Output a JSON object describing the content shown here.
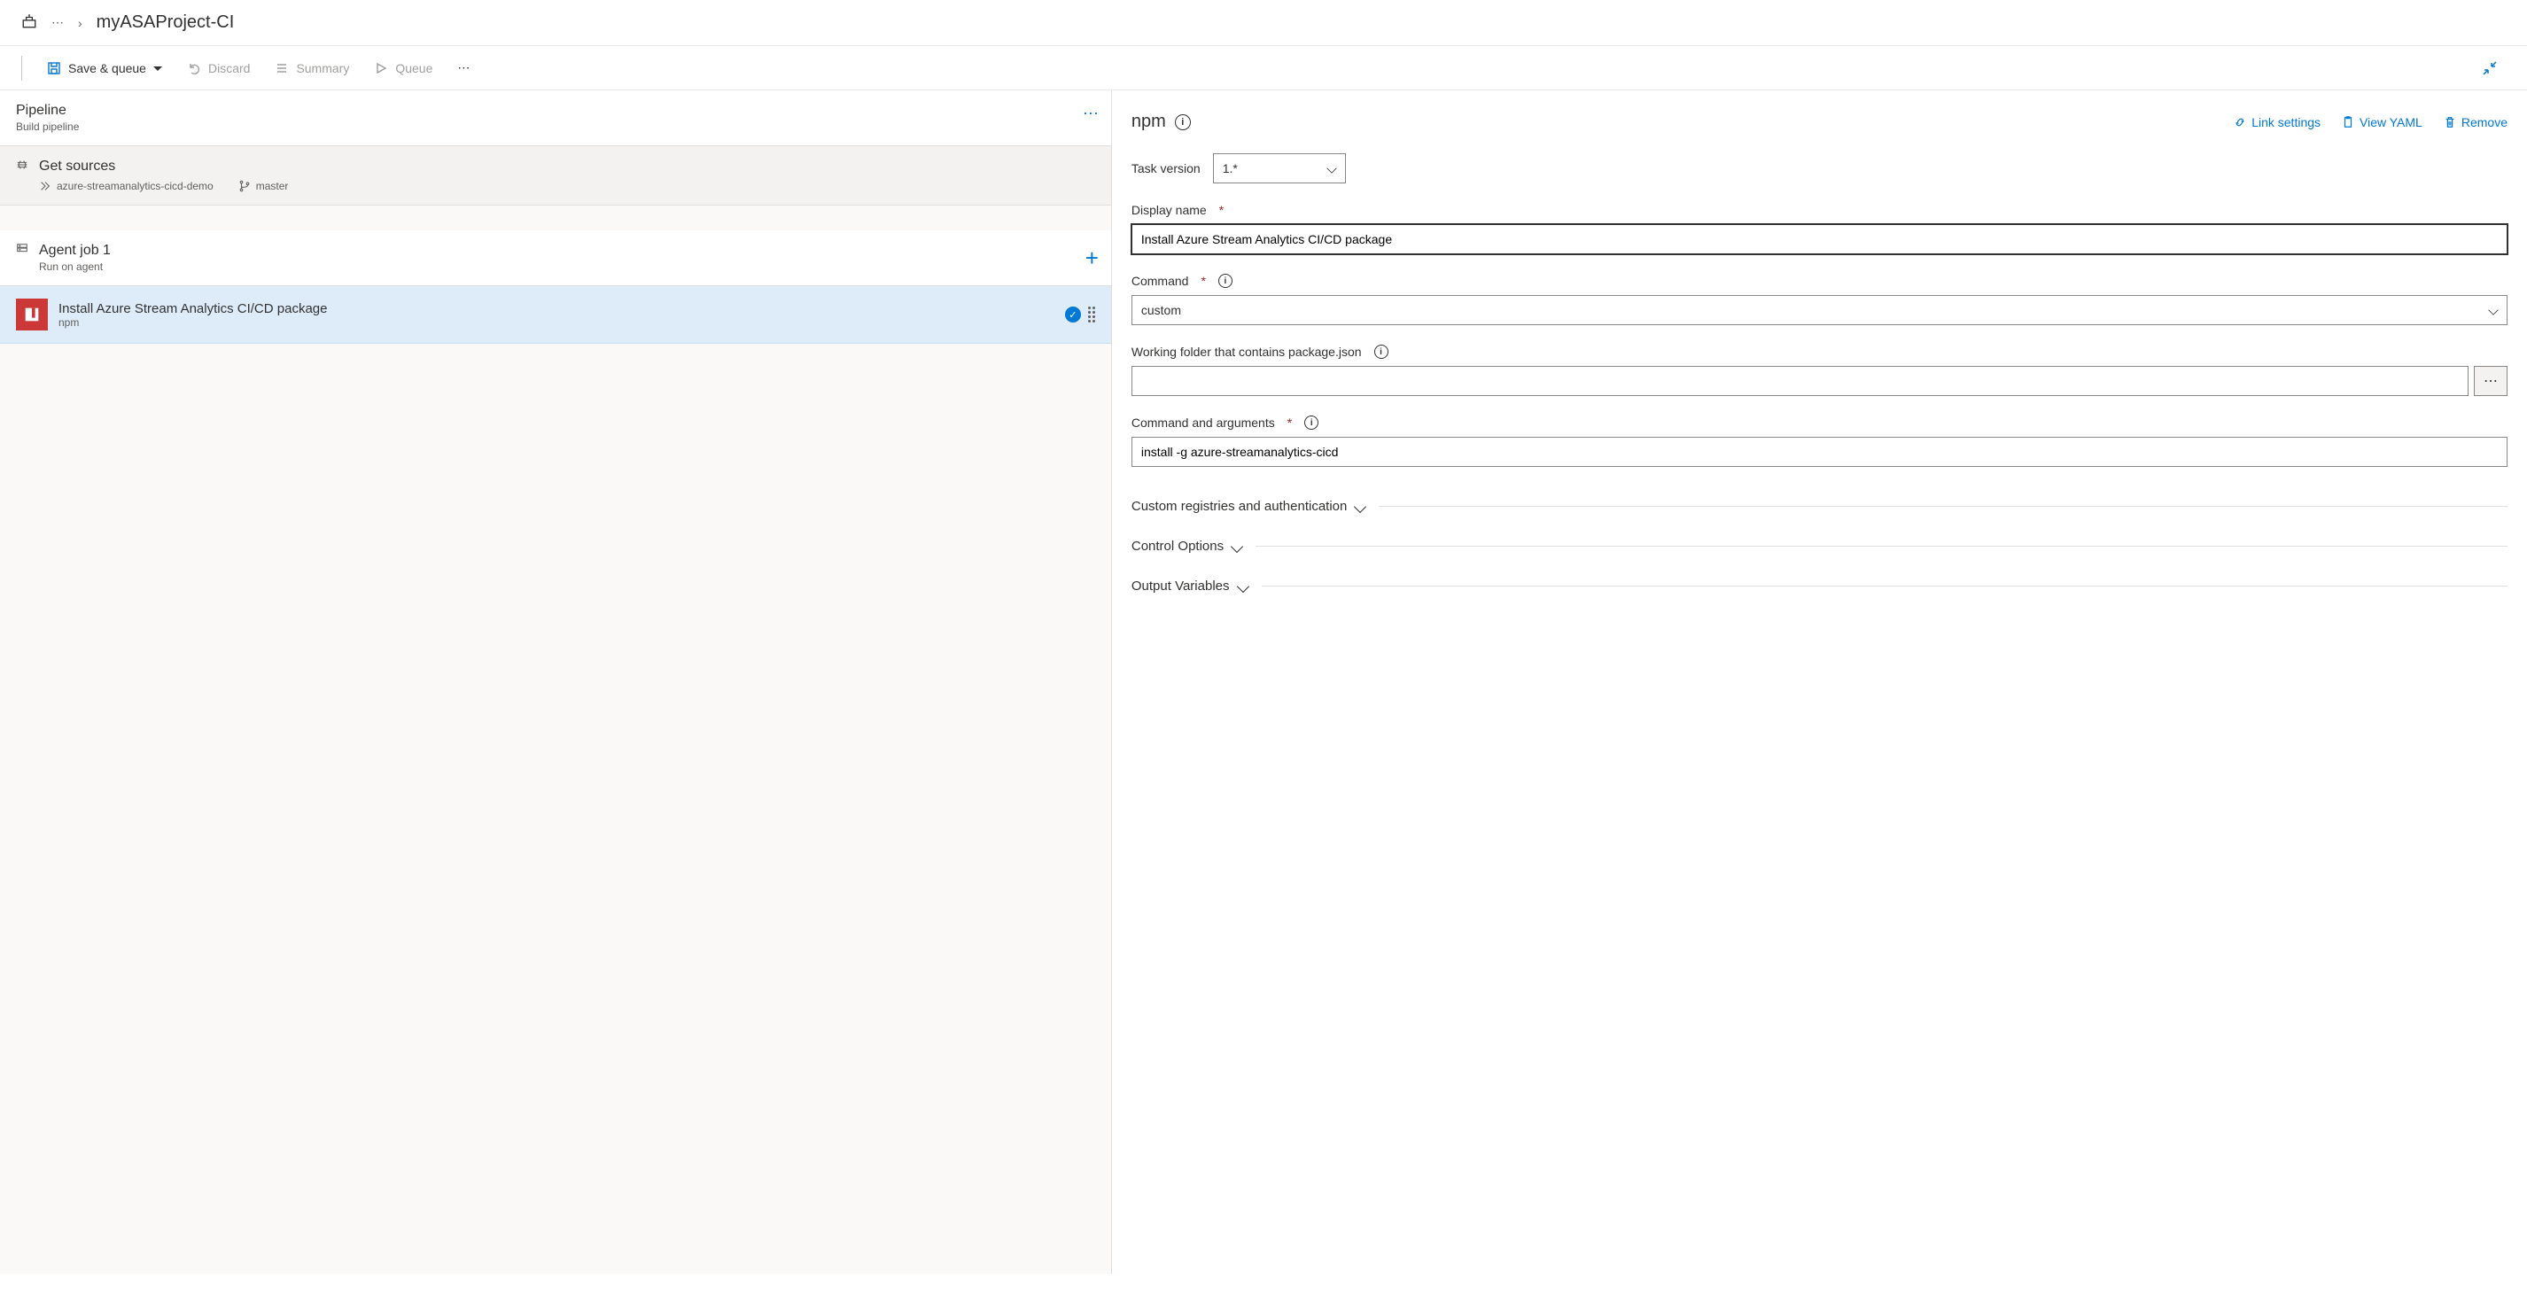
{
  "breadcrumb": {
    "title": "myASAProject-CI"
  },
  "toolbar": {
    "save_queue": "Save & queue",
    "discard": "Discard",
    "summary": "Summary",
    "queue": "Queue"
  },
  "left": {
    "pipeline": {
      "title": "Pipeline",
      "subtitle": "Build pipeline"
    },
    "sources": {
      "title": "Get sources",
      "repo": "azure-streamanalytics-cicd-demo",
      "branch": "master"
    },
    "agent_job": {
      "title": "Agent job 1",
      "subtitle": "Run on agent"
    },
    "task": {
      "title": "Install Azure Stream Analytics CI/CD package",
      "subtitle": "npm"
    }
  },
  "detail": {
    "title": "npm",
    "links": {
      "link_settings": "Link settings",
      "view_yaml": "View YAML",
      "remove": "Remove"
    },
    "task_version_label": "Task version",
    "task_version_value": "1.*",
    "display_name_label": "Display name",
    "display_name_value": "Install Azure Stream Analytics CI/CD package",
    "command_label": "Command",
    "command_value": "custom",
    "working_folder_label": "Working folder that contains package.json",
    "working_folder_value": "",
    "cmd_args_label": "Command and arguments",
    "cmd_args_value": "install -g azure-streamanalytics-cicd",
    "sections": {
      "registries": "Custom registries and authentication",
      "control": "Control Options",
      "output": "Output Variables"
    }
  }
}
